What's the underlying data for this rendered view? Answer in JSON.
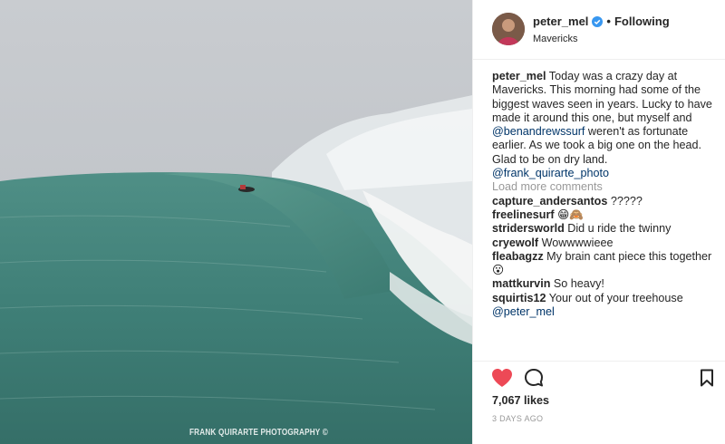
{
  "photo": {
    "alt_subject": "surfer on giant wave",
    "watermark": "FRANK QUIRARTE PHOTOGRAPHY ©"
  },
  "header": {
    "username": "peter_mel",
    "separator": "•",
    "follow_status": "Following",
    "location": "Mavericks"
  },
  "caption": {
    "username": "peter_mel",
    "text_1": " Today was a crazy day at Mavericks. This morning had some of the biggest waves seen in years. Lucky to have made it around this one, but myself and ",
    "mention_1": "@benandrewssurf",
    "text_2": " weren't as fortunate earlier. As we took a big one on the head. Glad to be on dry land. ",
    "mention_2": "@frank_quirarte_photo"
  },
  "load_more": "Load more comments",
  "comments": [
    {
      "user": "capture_andersantos",
      "text": " ?????"
    },
    {
      "user": "freelinesurf",
      "text": " 😁🙈"
    },
    {
      "user": "stridersworld",
      "text": " Did u ride the twinny"
    },
    {
      "user": "cryewolf",
      "text": " Wowwwwieee"
    },
    {
      "user": "fleabagzz",
      "text": " My brain cant piece this together 😮"
    },
    {
      "user": "mattkurvin",
      "text": " So heavy!"
    },
    {
      "user": "squirtis12",
      "text": " Your out of your treehouse ",
      "mention": "@peter_mel"
    }
  ],
  "actions": {
    "likes": "7,067 likes",
    "date": "3 DAYS AGO"
  },
  "colors": {
    "heart": "#ed4956",
    "verified": "#3897f0",
    "mention": "#003569",
    "muted": "#999999"
  },
  "icons": [
    "verified-badge-icon",
    "heart-icon",
    "comment-icon",
    "bookmark-icon"
  ]
}
